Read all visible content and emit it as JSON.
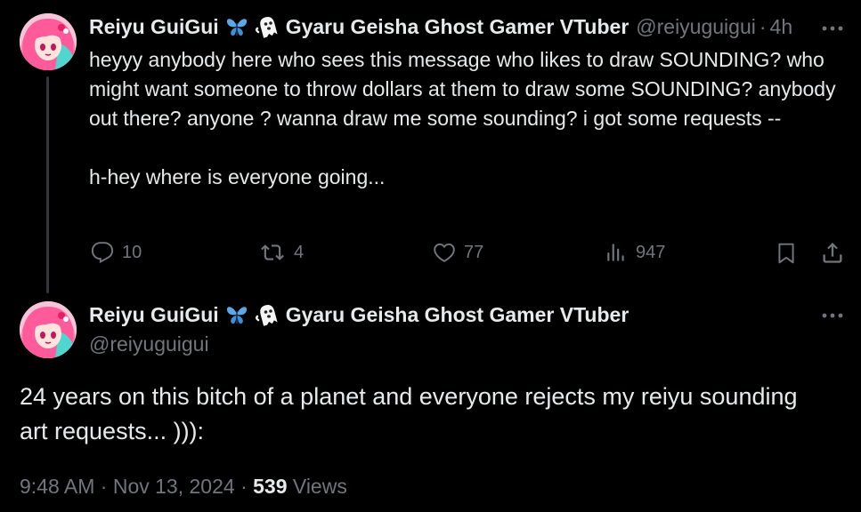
{
  "reply_tweet": {
    "display_name": "Reiyu GuiGui",
    "name_suffix": "Gyaru Geisha Ghost Gamer VTuber",
    "handle": "@reiyuguigui",
    "separator": "·",
    "timestamp": "4h",
    "paragraphs": [
      "heyyy anybody here who sees this message who likes to draw SOUNDING? who might want someone to throw dollars at them to draw some SOUNDING? anybody out there? anyone ? wanna draw me some sounding? i got some requests --",
      "h-hey where is everyone going..."
    ],
    "actions": {
      "reply_count": "10",
      "retweet_count": "4",
      "like_count": "77",
      "views_count": "947"
    },
    "icons": [
      "butterfly-emoji",
      "ghost-emoji",
      "more-icon",
      "reply-icon",
      "retweet-icon",
      "like-icon",
      "views-icon",
      "bookmark-icon",
      "share-icon"
    ]
  },
  "main_tweet": {
    "display_name": "Reiyu GuiGui",
    "name_suffix": "Gyaru Geisha Ghost Gamer VTuber",
    "handle": "@reiyuguigui",
    "text_lines": [
      "24 years on this bitch of a planet and everyone rejects my reiyu sounding",
      "art requests... ))):"
    ],
    "time": "9:48 AM",
    "date": "Nov 13, 2024",
    "separator": "·",
    "views_count": "539",
    "views_label": "Views"
  },
  "colors": {
    "background": "#000000",
    "text_primary": "#e7e9ea",
    "text_secondary": "#71767b",
    "thread_line": "#333639",
    "butterfly": "#5ba8e8"
  }
}
